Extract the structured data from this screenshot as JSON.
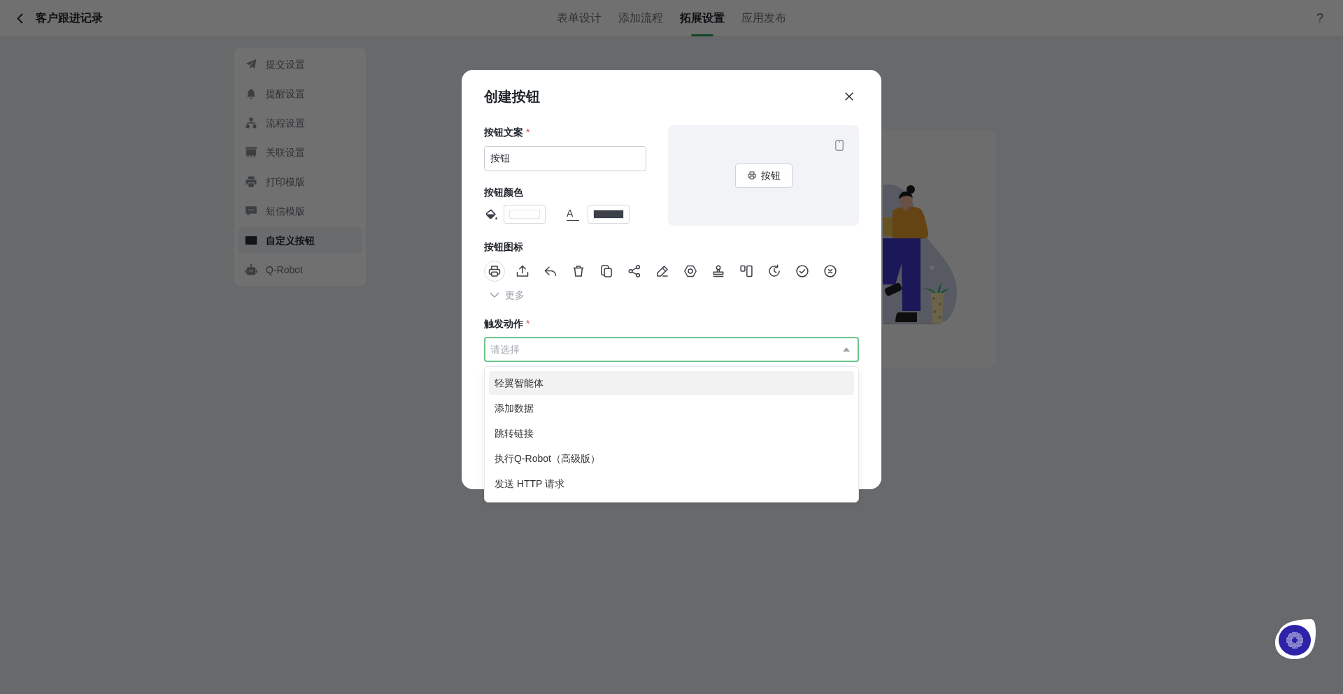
{
  "header": {
    "title": "客户跟进记录",
    "help": "?"
  },
  "tabs": [
    {
      "label": "表单设计",
      "selected": false
    },
    {
      "label": "添加流程",
      "selected": false
    },
    {
      "label": "拓展设置",
      "selected": true
    },
    {
      "label": "应用发布",
      "selected": false
    }
  ],
  "sidebar": {
    "items": [
      {
        "label": "提交设置",
        "selected": false
      },
      {
        "label": "提醒设置",
        "selected": false
      },
      {
        "label": "流程设置",
        "selected": false
      },
      {
        "label": "关联设置",
        "selected": false
      },
      {
        "label": "打印模版",
        "selected": false
      },
      {
        "label": "短信模版",
        "selected": false
      },
      {
        "label": "自定义按钮",
        "selected": true
      },
      {
        "label": "Q-Robot",
        "selected": false
      }
    ]
  },
  "dialog": {
    "title": "创建按钮",
    "text_field": {
      "label": "按钮文案",
      "required_mark": "*",
      "value": "按钮"
    },
    "color_field": {
      "label": "按钮颜色",
      "swatches": [
        {
          "kind": "fill",
          "color": "#ffffff"
        },
        {
          "kind": "text",
          "glyph": "A",
          "color": "#3c4048"
        }
      ]
    },
    "preview": {
      "button_label": "按钮"
    },
    "icon_field": {
      "label": "按钮图标",
      "options": [
        {
          "selected": true
        },
        {
          "selected": false
        },
        {
          "selected": false
        },
        {
          "selected": false
        },
        {
          "selected": false
        },
        {
          "selected": false
        },
        {
          "selected": false
        },
        {
          "selected": false
        },
        {
          "selected": false
        },
        {
          "selected": false
        },
        {
          "selected": false
        },
        {
          "selected": false
        },
        {
          "selected": false
        }
      ],
      "more": "更多"
    },
    "action_field": {
      "label": "触发动作",
      "required_mark": "*",
      "placeholder": "请选择",
      "expanded": true,
      "options": [
        {
          "label": "轻翼智能体",
          "highlighted": true
        },
        {
          "label": "添加数据",
          "highlighted": false
        },
        {
          "label": "跳转链接",
          "highlighted": false
        },
        {
          "label": "执行Q-Robot（高级版）",
          "highlighted": false
        },
        {
          "label": "发送 HTTP 请求",
          "highlighted": false
        }
      ]
    }
  }
}
